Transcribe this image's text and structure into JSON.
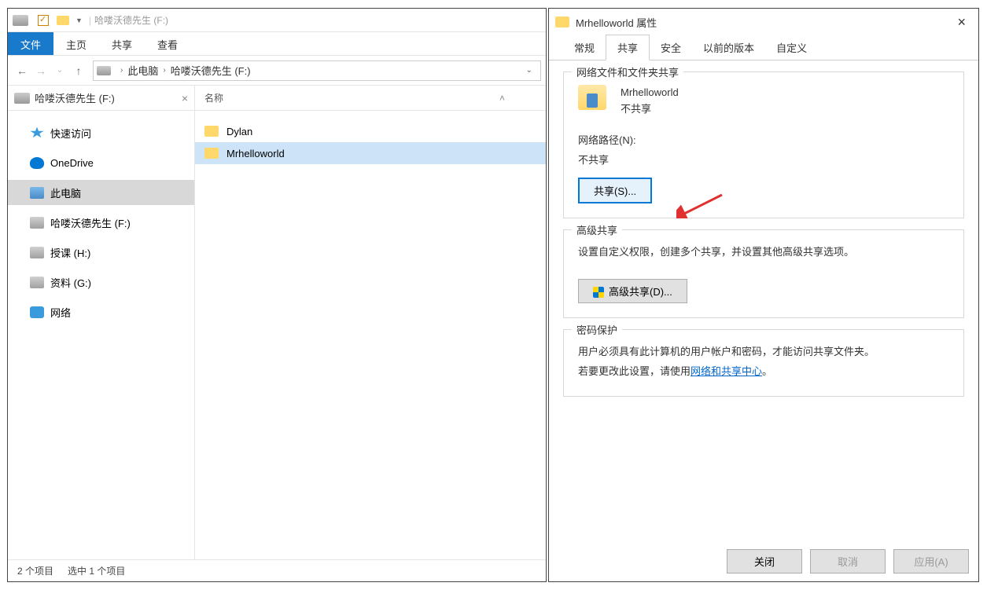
{
  "explorer": {
    "title": "哈喽沃德先生 (F:)",
    "ribbon": {
      "file": "文件",
      "home": "主页",
      "share": "共享",
      "view": "查看"
    },
    "breadcrumb": {
      "this_pc": "此电脑",
      "drive": "哈喽沃德先生 (F:)"
    },
    "tree": {
      "header": "哈喽沃德先生 (F:)",
      "quick_access": "快速访问",
      "onedrive": "OneDrive",
      "this_pc": "此电脑",
      "drive_f": "哈喽沃德先生 (F:)",
      "drive_h": "授课 (H:)",
      "drive_g": "资料 (G:)",
      "network": "网络"
    },
    "files": {
      "column_name": "名称",
      "items": [
        {
          "name": "Dylan"
        },
        {
          "name": "Mrhelloworld"
        }
      ]
    },
    "status": {
      "count": "2 个项目",
      "selected": "选中 1 个项目"
    }
  },
  "properties": {
    "title": "Mrhelloworld 属性",
    "tabs": {
      "general": "常规",
      "sharing": "共享",
      "security": "安全",
      "previous": "以前的版本",
      "custom": "自定义"
    },
    "group_share": {
      "title": "网络文件和文件夹共享",
      "name": "Mrhelloworld",
      "state": "不共享",
      "netpath_label": "网络路径(N):",
      "netpath_value": "不共享",
      "share_button": "共享(S)..."
    },
    "group_advanced": {
      "title": "高级共享",
      "desc": "设置自定义权限，创建多个共享，并设置其他高级共享选项。",
      "button": "高级共享(D)..."
    },
    "group_pwd": {
      "title": "密码保护",
      "line1": "用户必须具有此计算机的用户帐户和密码，才能访问共享文件夹。",
      "line2_prefix": "若要更改此设置，请使用",
      "link": "网络和共享中心",
      "line2_suffix": "。"
    },
    "buttons": {
      "close": "关闭",
      "cancel": "取消",
      "apply": "应用(A)"
    }
  }
}
